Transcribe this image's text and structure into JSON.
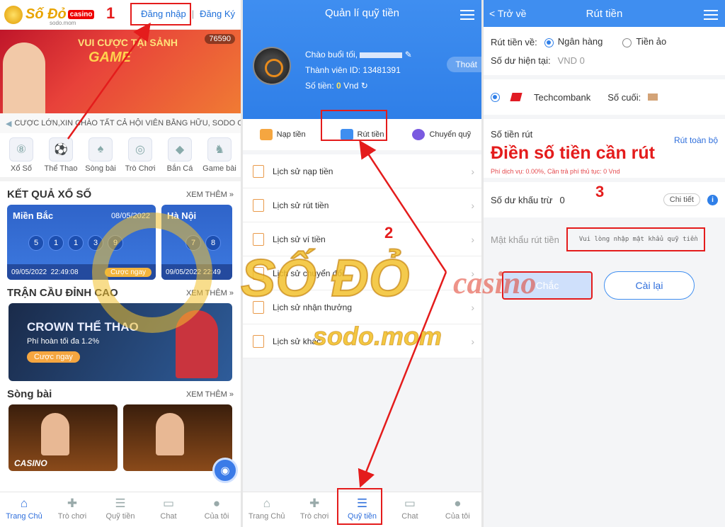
{
  "colors": {
    "accent": "#2f7fe8",
    "annotation": "#e41c1c",
    "gold": "#f2c12e"
  },
  "panel1": {
    "logo_text": "Số Đỏ",
    "logo_badge": "casino",
    "logo_sub": "sodo.mom",
    "step_number": "1",
    "login": "Đăng nhập",
    "divider": "|",
    "register": "Đăng Ký",
    "banner": {
      "headline": "VUI CƯỢC TẠI SẢNH",
      "brand": "GAME",
      "viewers": "76590"
    },
    "marquee": "CƯỢC LỚN,XIN CHÀO TẤT CẢ HỘI VIÊN BẰNG HỮU, SODO CAS",
    "games": [
      {
        "label": "Xổ Số",
        "icon": "lottery-icon"
      },
      {
        "label": "Thể Thao",
        "icon": "soccer-icon"
      },
      {
        "label": "Sòng bài",
        "icon": "cards-icon"
      },
      {
        "label": "Trò Chơi",
        "icon": "joystick-icon"
      },
      {
        "label": "Bắn Cá",
        "icon": "fish-icon"
      },
      {
        "label": "Game bài",
        "icon": "chess-icon"
      }
    ],
    "lottery": {
      "title": "KẾT QUẢ XỔ SỐ",
      "more": "XEM THÊM »",
      "cards": [
        {
          "name": "Miền Bắc",
          "date": "08/05/2022",
          "balls": [
            "5",
            "1",
            "1",
            "3",
            "9"
          ],
          "footer_date": "09/05/2022",
          "footer_time": "22:49:08",
          "bet": "Cược ngay"
        },
        {
          "name": "Hà Nội",
          "date": "",
          "balls": [
            "7",
            "8"
          ],
          "footer_date": "09/05/2022",
          "footer_time": "22:49",
          "bet": ""
        }
      ]
    },
    "match": {
      "title": "TRẬN CẦU ĐỈNH CAO",
      "more": "XEM THÊM »",
      "promo_title": "CROWN THỂ THAO",
      "promo_sub": "Phí hoàn tối đa 1.2%",
      "promo_btn": "Cược ngay"
    },
    "casino": {
      "title": "Sòng bài",
      "more": "XEM THÊM »",
      "card_logo": "CASINO"
    },
    "tabs": [
      {
        "label": "Trang Chủ",
        "icon": "home-icon",
        "active": true
      },
      {
        "label": "Trò chơi",
        "icon": "gamepad-icon"
      },
      {
        "label": "Quỹ tiền",
        "icon": "coins-icon"
      },
      {
        "label": "Chat",
        "icon": "chat-icon"
      },
      {
        "label": "Của tôi",
        "icon": "user-icon"
      }
    ]
  },
  "panel2": {
    "title": "Quản lí quỹ tiền",
    "greeting": "Chào buổi tối,",
    "member_id_label": "Thành viên ID:",
    "member_id": "13481391",
    "balance_label": "Số tiền:",
    "balance": "0",
    "currency": "Vnd",
    "logout": "Thoát",
    "actions": [
      "Nạp tiền",
      "Rút tiền",
      "Chuyển quỹ"
    ],
    "step_number": "2",
    "history": [
      "Lịch sử nạp tiền",
      "Lịch sử rút tiền",
      "Lịch sử ví tiền",
      "Lịch sử chuyển đổi",
      "Lịch sử nhận thưởng",
      "Lịch sử khác"
    ],
    "tabs": [
      {
        "label": "Trang Chủ",
        "icon": "home-icon"
      },
      {
        "label": "Trò chơi",
        "icon": "gamepad-icon"
      },
      {
        "label": "Quỹ tiền",
        "icon": "coins-icon",
        "active": true
      },
      {
        "label": "Chat",
        "icon": "chat-icon"
      },
      {
        "label": "Của tôi",
        "icon": "user-icon"
      }
    ]
  },
  "panel3": {
    "back": "< Trở về",
    "title": "Rút tiền",
    "withdraw_to_label": "Rút tiền về:",
    "option_bank": "Ngân hàng",
    "option_crypto": "Tiền ảo",
    "balance_label": "Số dư hiện tại:",
    "balance": "VND 0",
    "bank_name": "Techcombank",
    "last_digits_label": "Số cuối:",
    "amount_label": "Số tiền rút",
    "withdraw_all": "Rút toàn bộ",
    "amount_hint": "Điền số tiền cần rút",
    "fee_note": "Phí dịch vụ: 0.00%,  Cần trả phí thủ tục: 0 Vnd",
    "step_number": "3",
    "deduct_label": "Số dư khấu trừ",
    "deduct_value": "0",
    "detail_btn": "Chi tiết",
    "pw_label": "Mật khẩu rút tiền",
    "pw_placeholder": "Vui lòng nhập mật khẩu quỹ tiền",
    "confirm": "Chắc",
    "reset": "Cài lại"
  },
  "watermark": {
    "big": "SỐ ĐỎ",
    "casino": "casino",
    "domain": "sodo.mom"
  }
}
